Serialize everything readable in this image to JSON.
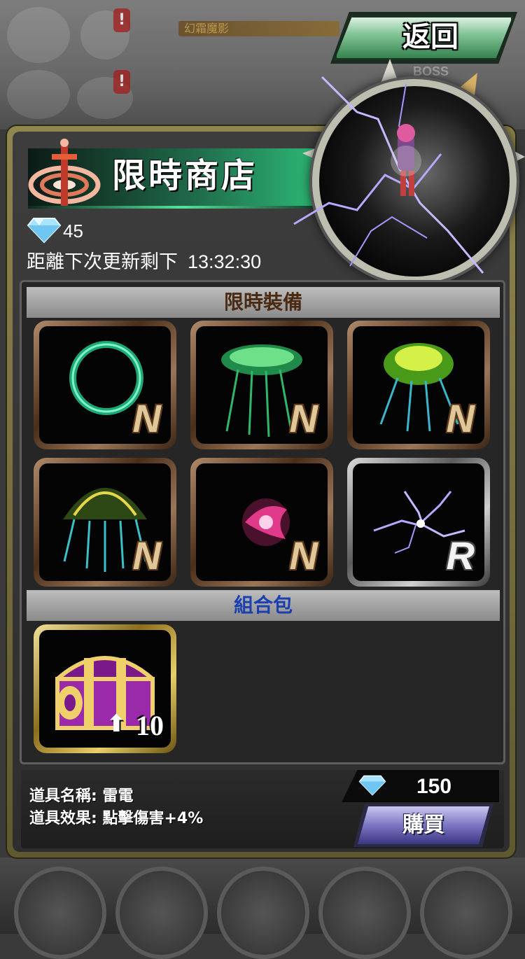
{
  "header": {
    "back_label": "返回",
    "boss_label": "BOSS",
    "event_bar_label": "幻霜魔影"
  },
  "shop": {
    "title": "限時商店",
    "gems": "45",
    "refresh_label": "距離下次更新剩下",
    "refresh_time": "13:32:30"
  },
  "sections": {
    "equipment": "限時裝備",
    "bundle": "組合包"
  },
  "equipment_items": [
    {
      "rarity": "N",
      "art": "green-ring-icon"
    },
    {
      "rarity": "N",
      "art": "green-jellyfish-icon"
    },
    {
      "rarity": "N",
      "art": "yellow-jellyfish-icon"
    },
    {
      "rarity": "N",
      "art": "rainbow-jellyfish-icon"
    },
    {
      "rarity": "N",
      "art": "pink-burst-icon"
    },
    {
      "rarity": "R",
      "art": "lightning-icon"
    }
  ],
  "bundle_items": [
    {
      "art": "treasure-chest-icon",
      "count": "10"
    }
  ],
  "selected_item": {
    "name_line": "道具名稱: 雷電",
    "effect_line": "道具效果: 點擊傷害+4%",
    "price": "150",
    "buy_label": "購買"
  },
  "colors": {
    "title_green": "#2fbf7a",
    "frame_gold": "#8f8650",
    "buy_purple": "#7b76c2",
    "rarity_n": "#e0c79a",
    "rarity_r": "#f2f2f2",
    "bundle_header": "#1a3fb0"
  }
}
